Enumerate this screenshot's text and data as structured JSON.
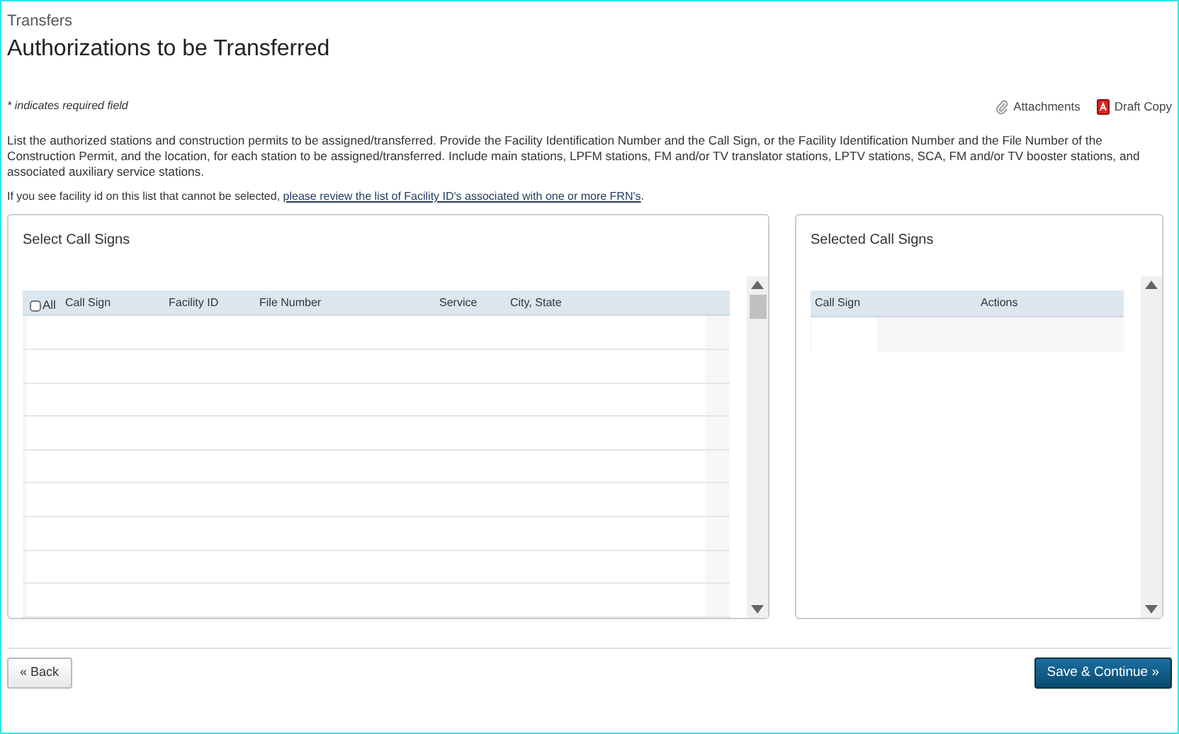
{
  "breadcrumb": "Transfers",
  "title": "Authorizations to be Transferred",
  "required_note": "* indicates required field",
  "tools": [
    {
      "kind": "attachments",
      "label": "Attachments"
    },
    {
      "kind": "pdf",
      "label": "Draft Copy"
    }
  ],
  "instructions": "List the authorized stations and construction permits to be assigned/transferred. Provide the Facility Identification Number and the Call Sign, or the Facility Identification Number and the File Number of the Construction Permit, and the location, for each station to be assigned/transferred. Include main stations, LPFM stations, FM and/or TV translator stations, LPTV stations, SCA, FM and/or TV booster stations, and associated auxiliary service stations.",
  "facility_note": {
    "text": "If you see facility id on this list that cannot be selected, ",
    "link": "please review the list of Facility ID's associated with one or more FRN's",
    "end": "."
  },
  "select_panel": {
    "title": "Select Call Signs",
    "all_label": "All",
    "all_checked": false,
    "columns": [
      "Call Sign",
      "Facility ID",
      "File Number",
      "Service",
      "City, State"
    ]
  },
  "selected_panel": {
    "title": "Selected Call Signs",
    "columns": [
      "Call Sign",
      "Actions"
    ]
  },
  "buttons": {
    "back": "« Back",
    "save": "Save & Continue »"
  }
}
